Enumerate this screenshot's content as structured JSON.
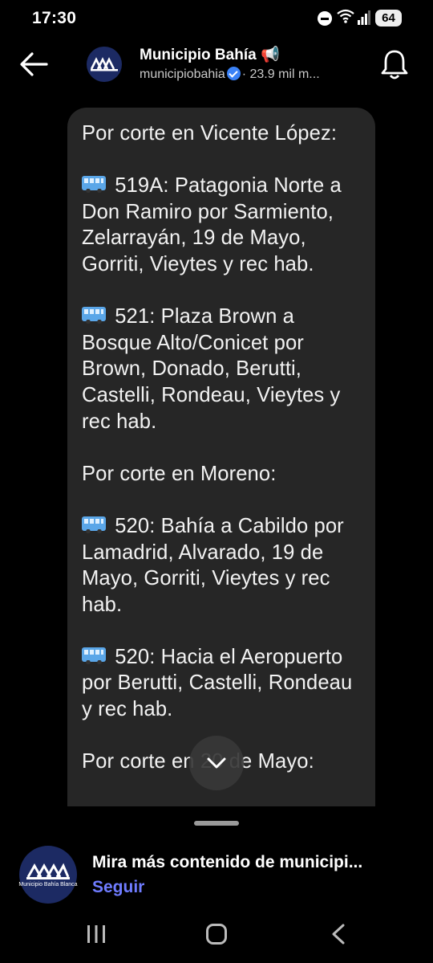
{
  "status_bar": {
    "time": "17:30",
    "battery": "64",
    "icons": [
      "dnd-icon",
      "wifi-icon",
      "signal-icon",
      "battery-icon"
    ]
  },
  "header": {
    "name": "Municipio Bahía 📢",
    "handle": "municipiobahia",
    "followers": "· 23.9 mil m...",
    "verified": true
  },
  "message": {
    "paragraphs": [
      "Por corte en Vicente López:",
      "519A: Patagonia Norte a Don Ramiro por Sarmiento, Zelarrayán, 19 de Mayo, Gorriti, Vieytes y rec hab.",
      "521: Plaza Brown a Bosque Alto/Conicet por Brown, Donado, Berutti, Castelli, Rondeau, Vieytes y rec hab.",
      "Por corte en Moreno:",
      "520: Bahía a Cabildo por Lamadrid, Alvarado, 19 de Mayo, Gorriti, Vieytes y rec hab.",
      "520: Hacia el Aeropuerto por  Berutti, Castelli, Rondeau y rec hab.",
      "Por corte en 20 de Mayo:"
    ]
  },
  "follow_card": {
    "logo_text": "Municipio Bahía Blanca",
    "title": "Mira más contenido de municipi...",
    "follow_label": "Seguir"
  },
  "colors": {
    "background": "#000000",
    "bubble": "#262626",
    "accent": "#6f7cff",
    "verified": "#3b82f6"
  }
}
